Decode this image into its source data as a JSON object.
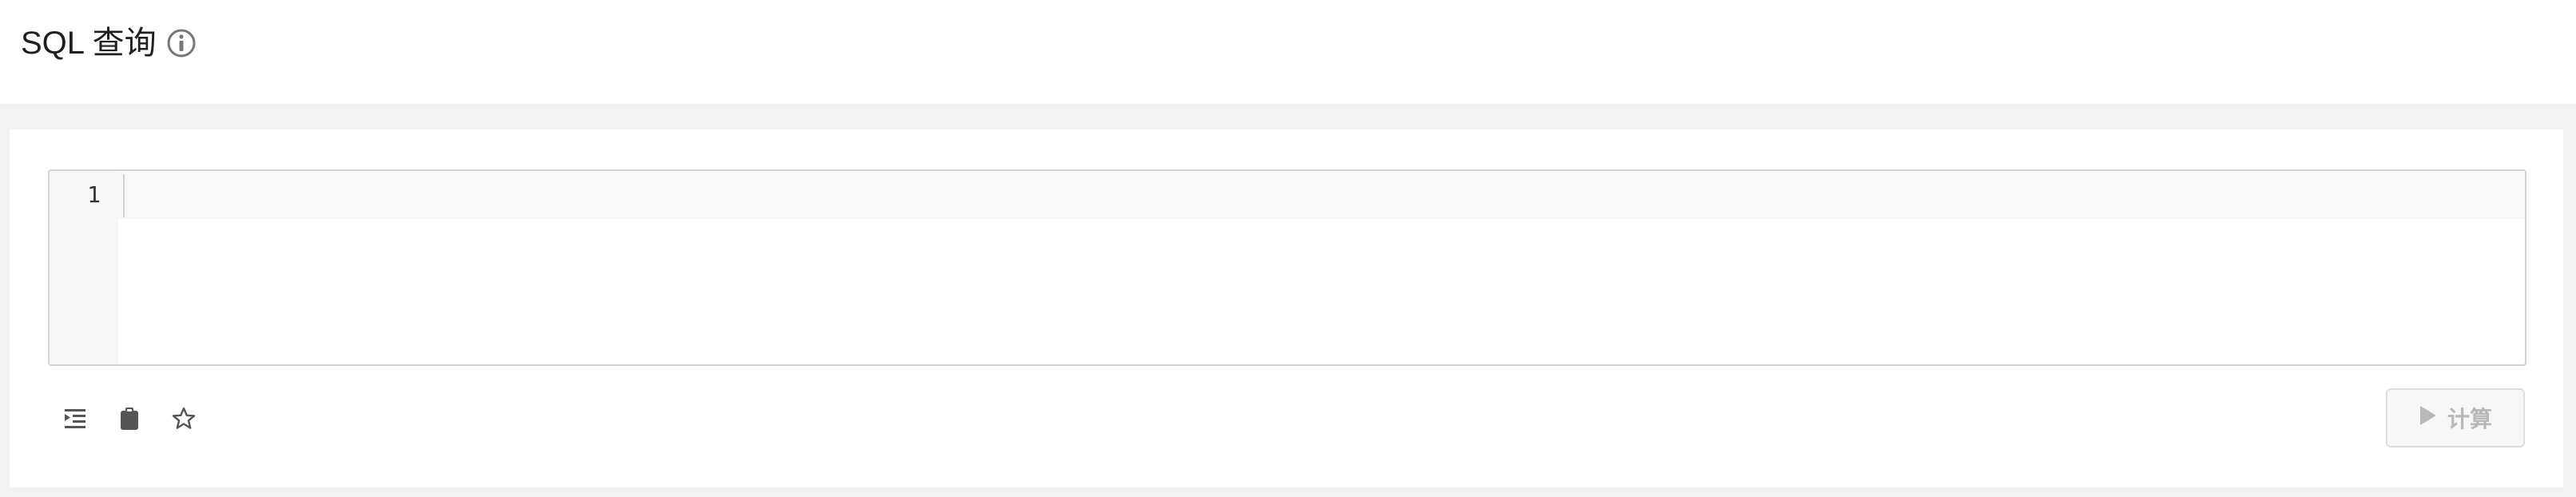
{
  "header": {
    "title": "SQL 查询",
    "info_icon": "info-circle-icon"
  },
  "editor": {
    "line_numbers": [
      "1"
    ],
    "content": ""
  },
  "toolbar": {
    "icons": [
      "indent-icon",
      "clipboard-icon",
      "star-icon"
    ],
    "run_button": {
      "label": "计算",
      "icon": "play-icon",
      "disabled": true
    }
  },
  "colors": {
    "background": "#f3f3f3",
    "panel": "#ffffff",
    "disabled_text": "#b8b8b8",
    "icon": "#555555"
  }
}
